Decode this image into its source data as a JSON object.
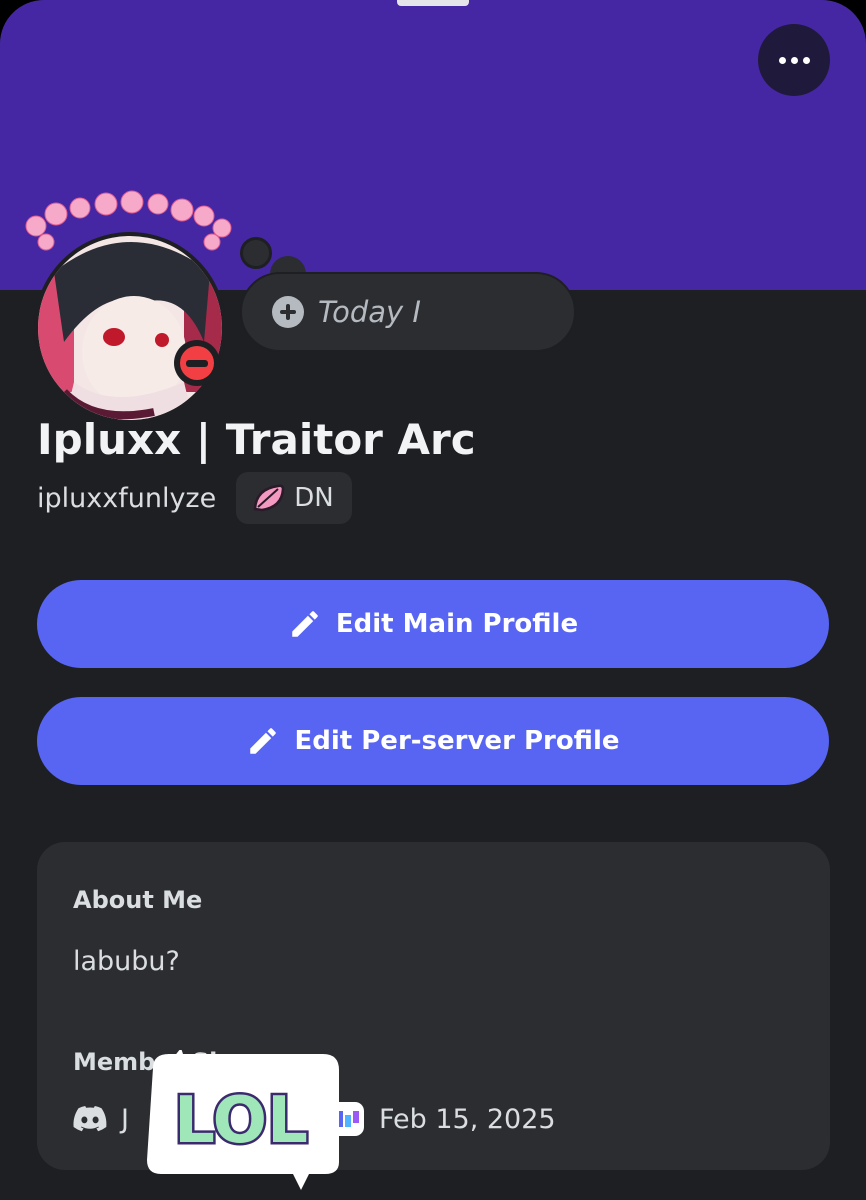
{
  "profile": {
    "display_name": "Ipluxx | Traitor Arc",
    "username": "ipluxxfunlyze",
    "tag": "DN",
    "custom_status": "Today I",
    "status": "do-not-disturb"
  },
  "actions": {
    "edit_main": "Edit Main Profile",
    "edit_server": "Edit Per-server Profile"
  },
  "about": {
    "title": "About Me",
    "text": "labubu?"
  },
  "member_since": {
    "title": "Member Since",
    "discord_date": "J",
    "server_date": "Feb 15, 2025"
  },
  "sticker": {
    "text": "LOL"
  },
  "colors": {
    "banner": "#4527a4",
    "background": "#1e1f22",
    "card": "#2b2d31",
    "button": "#5865f2",
    "dnd": "#f23f43"
  },
  "icons": {
    "more": "more-horizontal-icon",
    "add_status": "plus-circle-icon",
    "edit": "pencil-icon",
    "discord": "discord-logo-icon",
    "server": "server-icon",
    "tag": "leaf-icon"
  }
}
